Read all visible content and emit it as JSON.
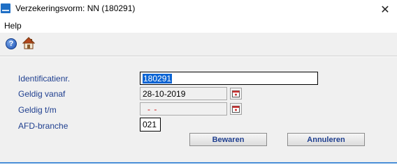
{
  "window": {
    "title": "Verzekeringsvorm: NN (180291)",
    "app_icon": "app-icon",
    "close_glyph": "✕"
  },
  "menu": {
    "items": [
      {
        "label": "Help"
      }
    ]
  },
  "toolbar": {
    "icons": [
      "help-icon",
      "home-icon"
    ],
    "help_glyph": "?"
  },
  "form": {
    "identificatie": {
      "label": "Identificatienr.",
      "value": "180291"
    },
    "geldig_vanaf": {
      "label": "Geldig vanaf",
      "value": "28-10-2019"
    },
    "geldig_tm": {
      "label": "Geldig t/m",
      "value": "- -"
    },
    "afd_branche": {
      "label": "AFD-branche",
      "value": "021"
    }
  },
  "buttons": {
    "save": "Bewaren",
    "cancel": "Annuleren"
  },
  "colors": {
    "label": "#1f3f8f",
    "selection": "#0a64d4",
    "empty_date": "#d01010",
    "accent_line": "#4a8fd8"
  }
}
